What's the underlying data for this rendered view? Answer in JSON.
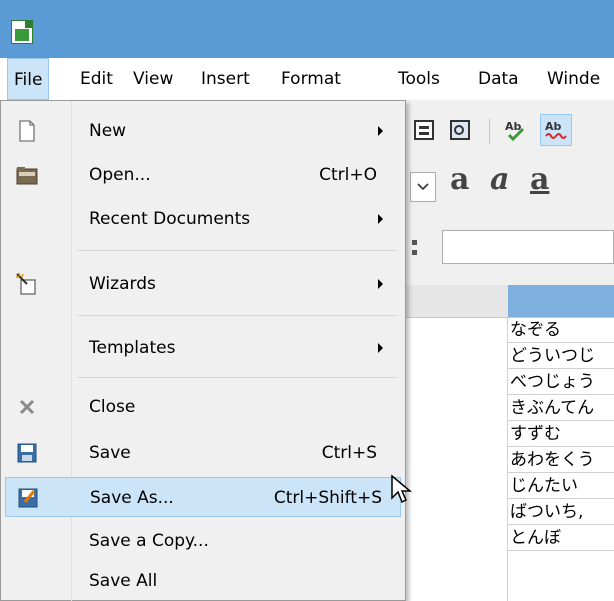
{
  "menubar": [
    {
      "label": "File"
    },
    {
      "label": "Edit"
    },
    {
      "label": "View"
    },
    {
      "label": "Insert"
    },
    {
      "label": "Format"
    },
    {
      "label": "Tools"
    },
    {
      "label": "Data"
    },
    {
      "label": "Winde"
    }
  ],
  "file_menu": {
    "items": [
      {
        "label": "New",
        "shortcut": "",
        "submenu": true,
        "icon": "new-document-icon"
      },
      {
        "label": "Open...",
        "shortcut": "Ctrl+O",
        "submenu": false,
        "icon": "open-folder-icon"
      },
      {
        "label": "Recent Documents",
        "shortcut": "",
        "submenu": true,
        "icon": ""
      },
      {
        "label": "Wizards",
        "shortcut": "",
        "submenu": true,
        "icon": "wizard-icon"
      },
      {
        "label": "Templates",
        "shortcut": "",
        "submenu": true,
        "icon": ""
      },
      {
        "label": "Close",
        "shortcut": "",
        "submenu": false,
        "icon": "close-x-icon"
      },
      {
        "label": "Save",
        "shortcut": "Ctrl+S",
        "submenu": false,
        "icon": "save-disk-icon"
      },
      {
        "label": "Save As...",
        "shortcut": "Ctrl+Shift+S",
        "submenu": false,
        "icon": "save-as-icon",
        "highlighted": true
      },
      {
        "label": "Save a Copy...",
        "shortcut": "",
        "submenu": false,
        "icon": ""
      },
      {
        "label": "Save All",
        "shortcut": "",
        "submenu": false,
        "icon": ""
      }
    ]
  },
  "sheet": {
    "cells": [
      "なぞる",
      "どういつじ",
      "べつじょう",
      "きぶんてん",
      "すずむ",
      "あわをくう",
      "じんたい",
      "ばついち,",
      "とんぼ"
    ]
  },
  "colors": {
    "titlebar": "#5b9bd5",
    "highlight": "#cce4f7",
    "highlight_border": "#99c9ef",
    "column_selected": "#7fb1e0"
  }
}
